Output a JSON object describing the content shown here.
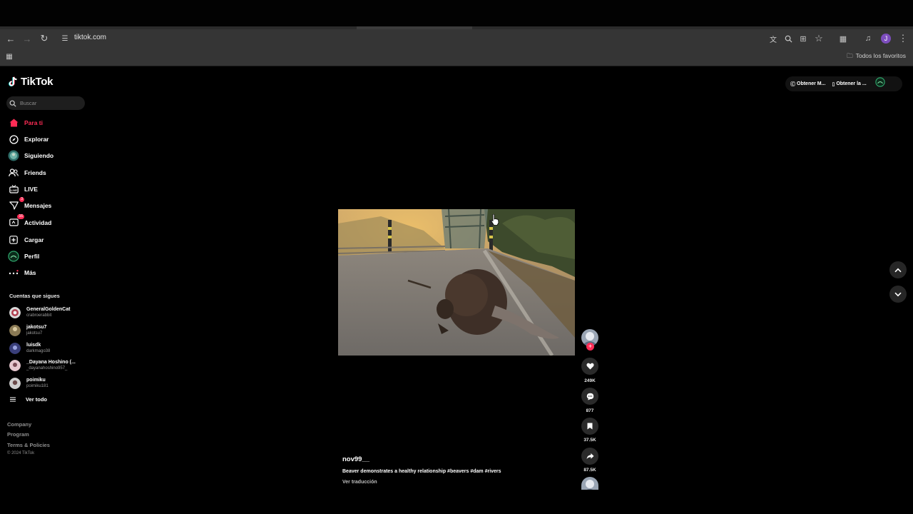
{
  "browser": {
    "url": "tiktok.com",
    "bookmarks_label": "Todos los favoritos",
    "profile_initial": "J"
  },
  "app": {
    "logo_text": "TikTok",
    "accent_color": "#fe2c55"
  },
  "search": {
    "placeholder": "Buscar"
  },
  "nav": [
    {
      "label": "Para ti",
      "icon": "home-icon",
      "active": true
    },
    {
      "label": "Explorar",
      "icon": "compass-icon"
    },
    {
      "label": "Siguiendo",
      "icon": "following-avatar-icon"
    },
    {
      "label": "Friends",
      "icon": "friends-icon"
    },
    {
      "label": "LIVE",
      "icon": "live-tv-icon"
    },
    {
      "label": "Mensajes",
      "icon": "messages-icon",
      "badge": "3"
    },
    {
      "label": "Actividad",
      "icon": "activity-icon",
      "badge": "16"
    },
    {
      "label": "Cargar",
      "icon": "upload-icon"
    },
    {
      "label": "Perfil",
      "icon": "profile-icon"
    },
    {
      "label": "Más",
      "icon": "more-icon"
    }
  ],
  "following": {
    "title": "Cuentas que sigues",
    "accounts": [
      {
        "name": "GeneralGoldenCat",
        "username": "crabroerabbit"
      },
      {
        "name": "jakotsu7",
        "username": "jakotsu7"
      },
      {
        "name": "luisdk",
        "username": "darkmago38"
      },
      {
        "name": "_Dayana Hoshino (...",
        "username": "_dayanahoshino957_"
      },
      {
        "name": "poimiku",
        "username": "poimiku181"
      }
    ],
    "see_all": "Ver todo"
  },
  "footer": {
    "links": [
      "Company",
      "Program",
      "Terms & Policies"
    ],
    "copyright": "© 2024 TikTok"
  },
  "topbar": {
    "get_coins": "Obtener M...",
    "get_app": "Obtener la ..."
  },
  "video": {
    "author": "nov99__",
    "caption": "Beaver demonstrates a healthy relationship #beavers #dam #rivers",
    "translate": "Ver traducción",
    "likes": "249K",
    "comments": "877",
    "saves": "37.5K",
    "shares": "87.5K"
  }
}
